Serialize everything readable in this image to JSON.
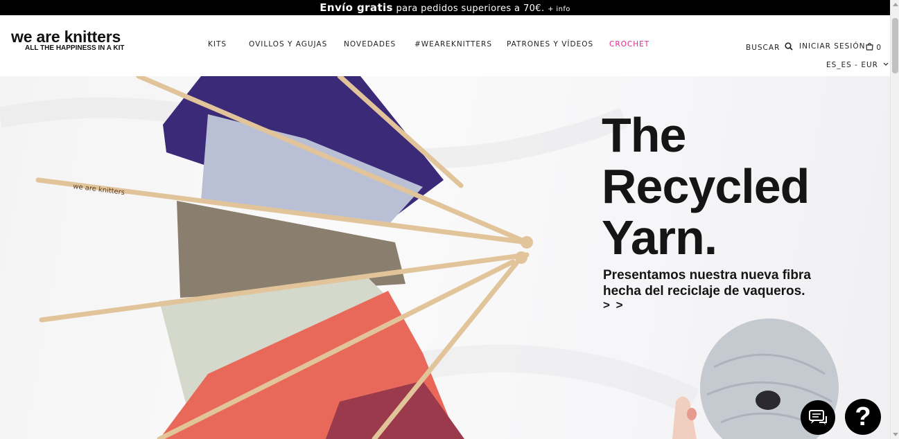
{
  "promo": {
    "bold": "Envío gratis",
    "text": "para pedidos superiores a 70€.",
    "info": "+ info"
  },
  "logo": {
    "name": "we are knitters",
    "tagline": "ALL THE HAPPINESS IN A KIT"
  },
  "nav": {
    "items": [
      {
        "label": "KITS"
      },
      {
        "label": "OVILLOS Y AGUJAS"
      },
      {
        "label": "NOVEDADES"
      },
      {
        "label": "#WEAREKNITTERS"
      },
      {
        "label": "PATRONES Y VÍDEOS"
      },
      {
        "label": "CROCHET"
      }
    ],
    "highlight_color": "#e0268f"
  },
  "tools": {
    "search": "BUSCAR",
    "login": "INICIAR SESIÓN",
    "cart_count": "0",
    "locale": "ES_ES - EUR"
  },
  "hero": {
    "title_line1": "The",
    "title_line2": "Recycled",
    "title_line3": "Yarn.",
    "subtitle_line1": "Presentamos nuestra nueva fibra",
    "subtitle_line2": "hecha del reciclaje de vaqueros.",
    "cta": "> >",
    "needle_brand": "we are knitters"
  },
  "widgets": {
    "help": "?"
  }
}
